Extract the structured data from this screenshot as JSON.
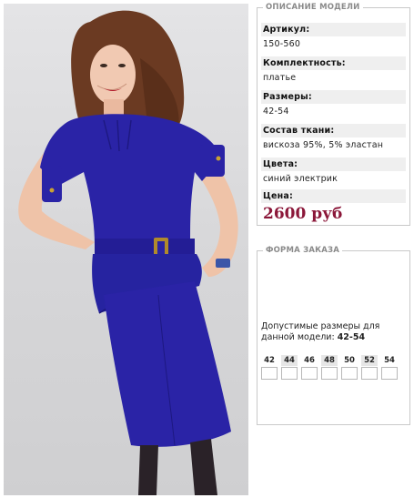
{
  "description": {
    "legend": "ОПИСАНИЕ МОДЕЛИ",
    "fields": [
      {
        "label": "Артикул:",
        "value": "150-560"
      },
      {
        "label": "Комплектность:",
        "value": "платье"
      },
      {
        "label": "Размеры:",
        "value": "42-54"
      },
      {
        "label": "Состав ткани:",
        "value": "вискоза 95%, 5% эластан"
      },
      {
        "label": "Цвета:",
        "value": "синий электрик"
      }
    ],
    "price_label": "Цена:",
    "price": "2600 руб",
    "price_color": "#8b1739"
  },
  "order": {
    "legend": "ФОРМА ЗАКАЗА",
    "note_text": "Допустимые размеры для данной модели: ",
    "note_sizes": "42-54",
    "sizes": [
      "42",
      "44",
      "46",
      "48",
      "50",
      "52",
      "54"
    ]
  },
  "photo": {
    "dress_color": "#2a23a6"
  }
}
